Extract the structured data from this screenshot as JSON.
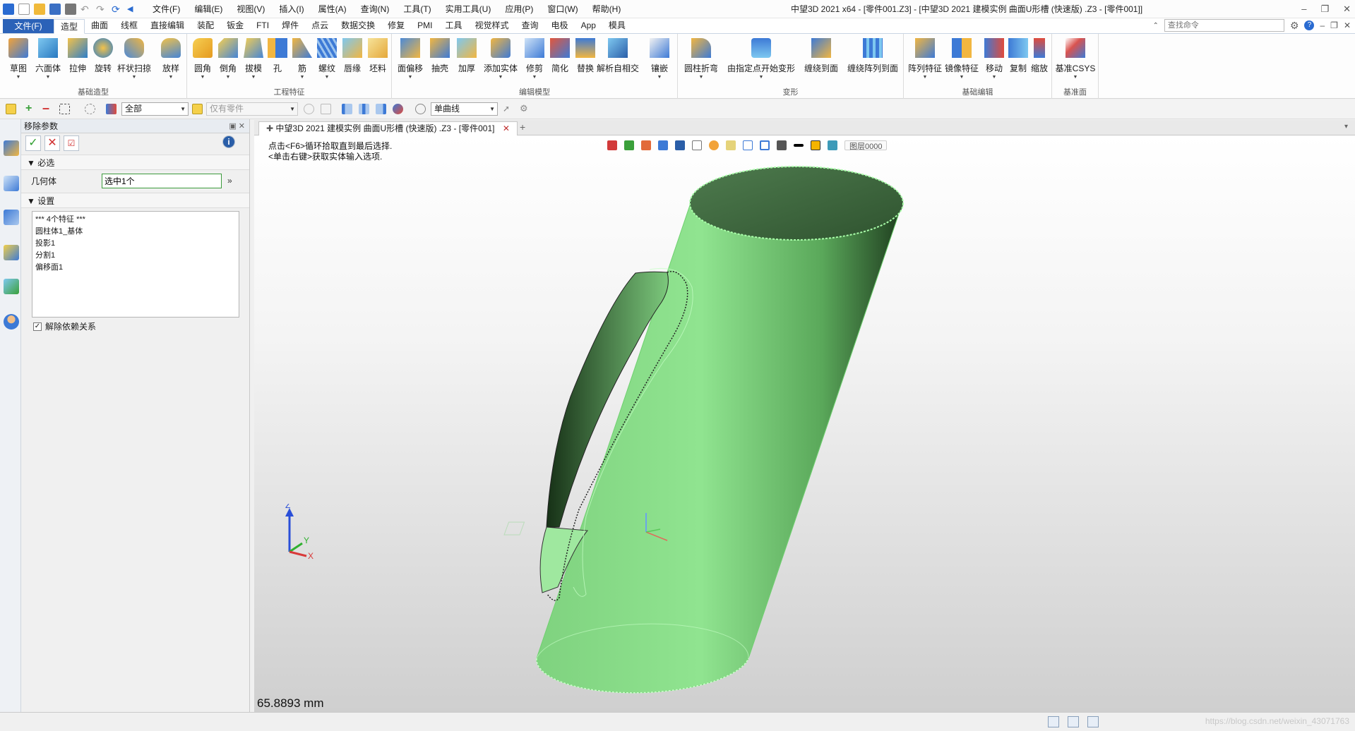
{
  "app": {
    "window_title": "中望3D 2021 x64 - [零件001.Z3] - [中望3D 2021 建模实例 曲面U形槽 (快速版) .Z3 - [零件001]]",
    "menus": [
      "文件(F)",
      "编辑(E)",
      "视图(V)",
      "插入(I)",
      "属性(A)",
      "查询(N)",
      "工具(T)",
      "实用工具(U)",
      "应用(P)",
      "窗口(W)",
      "帮助(H)"
    ]
  },
  "ribbon_tabs": {
    "file": "文件(F)",
    "tabs": [
      "造型",
      "曲面",
      "线框",
      "直接编辑",
      "装配",
      "钣金",
      "FTI",
      "焊件",
      "点云",
      "数据交换",
      "修复",
      "PMI",
      "工具",
      "视觉样式",
      "查询",
      "电极",
      "App",
      "模具"
    ],
    "active": "造型",
    "search_placeholder": "查找命令"
  },
  "ribbon": {
    "basic_shapes": {
      "label": "基础造型",
      "buttons": [
        "草图",
        "六面体",
        "拉伸",
        "旋转",
        "杆状扫掠",
        "放样"
      ]
    },
    "engineering": {
      "label": "工程特征",
      "buttons": [
        "圆角",
        "倒角",
        "拔模",
        "孔",
        "筋",
        "螺纹",
        "唇缘",
        "坯料"
      ]
    },
    "edit_model": {
      "label": "编辑模型",
      "buttons": [
        "面偏移",
        "抽壳",
        "加厚",
        "添加实体",
        "修剪",
        "简化",
        "替换",
        "解析自相交",
        "镶嵌"
      ]
    },
    "deform": {
      "label": "变形",
      "buttons": [
        "圆柱折弯",
        "由指定点开始变形",
        "缠绕到面",
        "缠绕阵列到面"
      ]
    },
    "basic_edit": {
      "label": "基础编辑",
      "buttons": [
        "阵列特征",
        "镜像特征",
        "移动",
        "复制",
        "缩放"
      ]
    },
    "datum": {
      "label": "基准面",
      "buttons": [
        "基准CSYS"
      ]
    }
  },
  "toolbar2": {
    "filter": "全部",
    "part_filter": "仅有零件",
    "curve_mode": "单曲线"
  },
  "panel": {
    "title": "移除参数",
    "required_section": "必选",
    "geometry_label": "几何体",
    "geometry_value": "选中1个",
    "settings_section": "设置",
    "features": [
      "*** 4个特征 ***",
      "圆柱体1_基体",
      "投影1",
      "分割1",
      "偏移面1"
    ],
    "release_dependency": "解除依赖关系",
    "release_checked": true
  },
  "document": {
    "tab_label": "中望3D 2021 建模实例 曲面U形槽 (快速版) .Z3 - [零件001]"
  },
  "viewport": {
    "hint_line1": "点击<F6>循环拾取直到最后选择.",
    "hint_line2": "<单击右键>获取实体输入选项.",
    "layer": "图层0000",
    "distance": "65.8893 mm",
    "axes": {
      "x": "X",
      "y": "Y",
      "z": "Z"
    },
    "model_color": "#8fe08f"
  },
  "statusbar": {
    "watermark": "https://blog.csdn.net/weixin_43071763"
  }
}
